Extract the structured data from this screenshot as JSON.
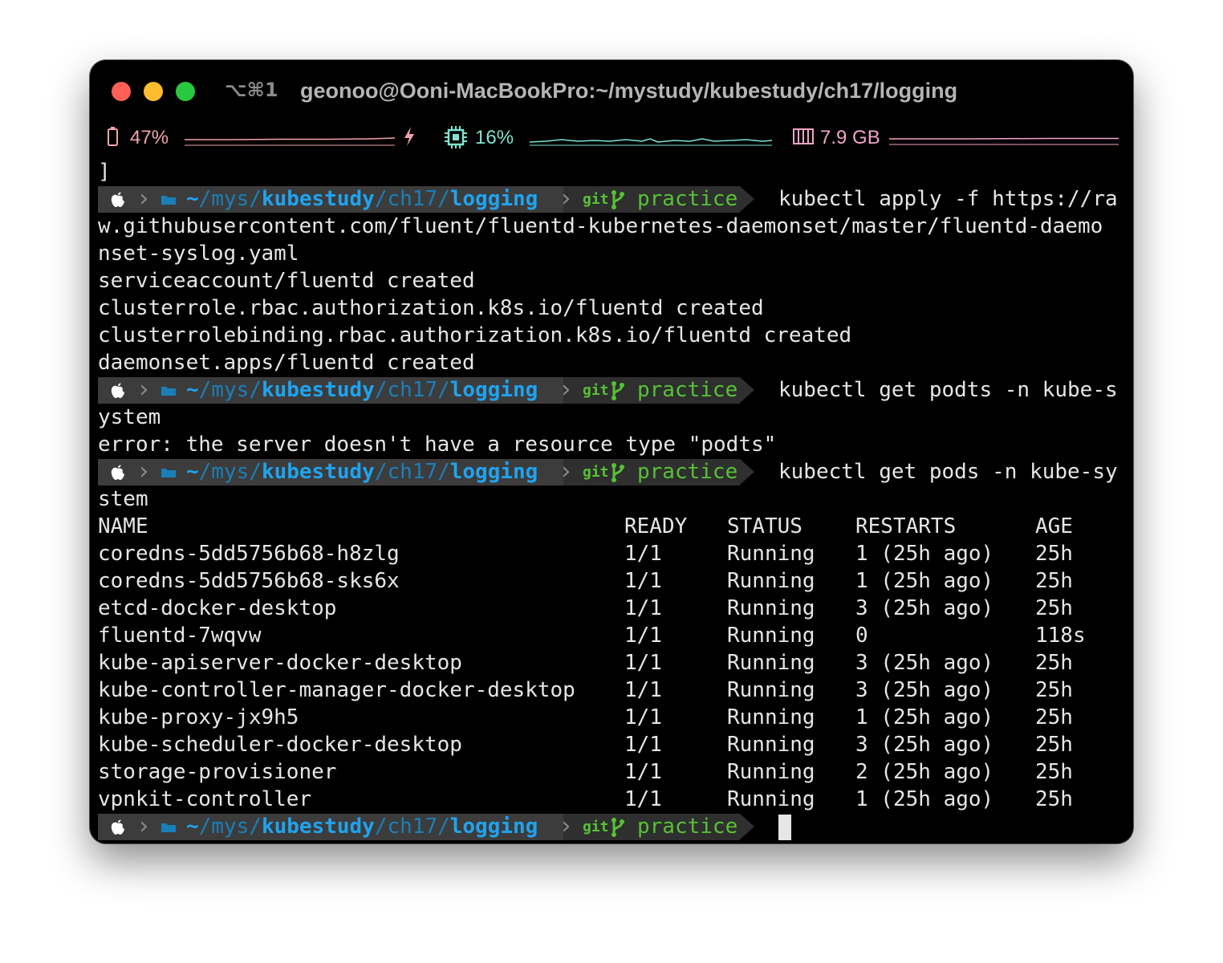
{
  "window": {
    "shortcut": "⌥⌘1",
    "title": "geonoo@Ooni-MacBookPro:~/mystudy/kubestudy/ch17/logging"
  },
  "status": {
    "battery": "47%",
    "cpu": "16%",
    "memory": "7.9 GB",
    "colors": {
      "battery": "#f2a3a9",
      "cpu": "#7ee3d0",
      "memory": "#f2a3c9"
    }
  },
  "prompt": {
    "path_home": "~",
    "path_dim1": "/mys/",
    "path_bold1": "kubestudy",
    "path_dim2": "/ch17/",
    "path_bold2": "logging",
    "git_label": "git",
    "branch": "practice"
  },
  "lines": {
    "l0": "]",
    "cmd1": "kubectl apply -f https://ra",
    "l2": "w.githubusercontent.com/fluent/fluentd-kubernetes-daemonset/master/fluentd-daemo",
    "l3": "nset-syslog.yaml",
    "l4": "serviceaccount/fluentd created",
    "l5": "clusterrole.rbac.authorization.k8s.io/fluentd created",
    "l6": "clusterrolebinding.rbac.authorization.k8s.io/fluentd created",
    "l7": "daemonset.apps/fluentd created",
    "cmd2": "kubectl get podts -n kube-s",
    "l9": "ystem",
    "l10": "error: the server doesn't have a resource type \"podts\"",
    "cmd3": "kubectl get pods -n kube-sy",
    "l12": "stem"
  },
  "table": {
    "headers": [
      "NAME",
      "READY",
      "STATUS",
      "RESTARTS",
      "AGE"
    ],
    "rows": [
      [
        "coredns-5dd5756b68-h8zlg",
        "1/1",
        "Running",
        "1 (25h ago)",
        "25h"
      ],
      [
        "coredns-5dd5756b68-sks6x",
        "1/1",
        "Running",
        "1 (25h ago)",
        "25h"
      ],
      [
        "etcd-docker-desktop",
        "1/1",
        "Running",
        "3 (25h ago)",
        "25h"
      ],
      [
        "fluentd-7wqvw",
        "1/1",
        "Running",
        "0",
        "118s"
      ],
      [
        "kube-apiserver-docker-desktop",
        "1/1",
        "Running",
        "3 (25h ago)",
        "25h"
      ],
      [
        "kube-controller-manager-docker-desktop",
        "1/1",
        "Running",
        "3 (25h ago)",
        "25h"
      ],
      [
        "kube-proxy-jx9h5",
        "1/1",
        "Running",
        "1 (25h ago)",
        "25h"
      ],
      [
        "kube-scheduler-docker-desktop",
        "1/1",
        "Running",
        "3 (25h ago)",
        "25h"
      ],
      [
        "storage-provisioner",
        "1/1",
        "Running",
        "2 (25h ago)",
        "25h"
      ],
      [
        "vpnkit-controller",
        "1/1",
        "Running",
        "1 (25h ago)",
        "25h"
      ]
    ]
  }
}
